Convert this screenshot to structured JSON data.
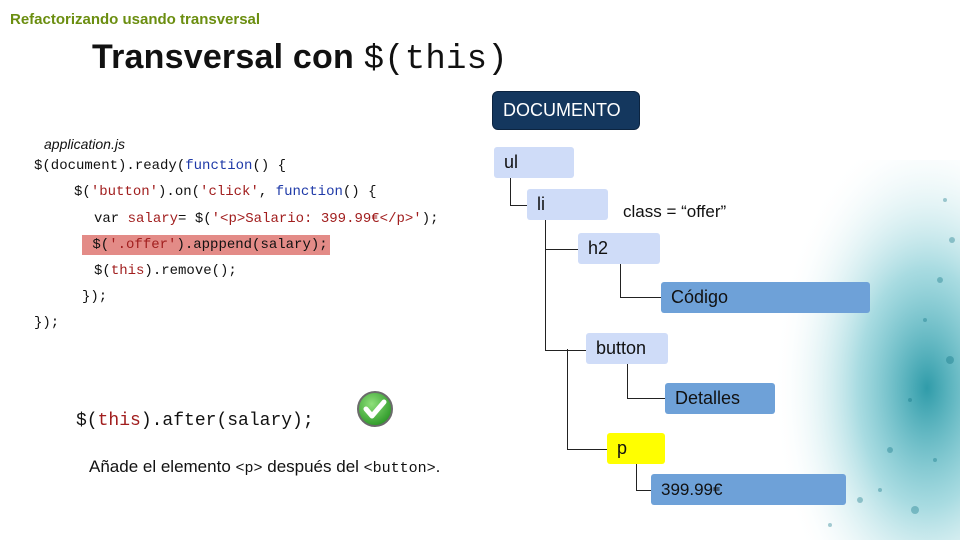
{
  "slide": {
    "section": "Refactorizando usando transversal",
    "title_text": "Transversal con ",
    "title_code": "$(this)",
    "filename": "application.js"
  },
  "code_lines": [
    "$(document).ready(function() {",
    "$('button').on('click', function() {",
    "var salary= $('<p>Salario: 399.99€</p>');",
    "$('.offer').apppend(salary);",
    "$(this).remove();",
    "});",
    "});"
  ],
  "after_code": "$(this).after(salary);",
  "description": {
    "part1": "Añade el elemento ",
    "tag1": "<p>",
    "part2": " después del ",
    "tag2": "<button>",
    "part3": "."
  },
  "tree": {
    "root": "DOCUMENTO",
    "ul": "ul",
    "li": "li",
    "li_class": "class = “offer”",
    "h2": "h2",
    "h2_text": "Código",
    "button": "button",
    "button_text": "Detalles",
    "p": "p",
    "p_text": "399.99€"
  },
  "colors": {
    "section": "#6b8e10",
    "doc_node": "#14375e",
    "element_node": "#cfdcf8",
    "text_node": "#6ea1d8",
    "highlight_node": "#ffff00",
    "code_highlight": "#e38b87"
  },
  "icons": {
    "check": "check-circle-icon"
  }
}
